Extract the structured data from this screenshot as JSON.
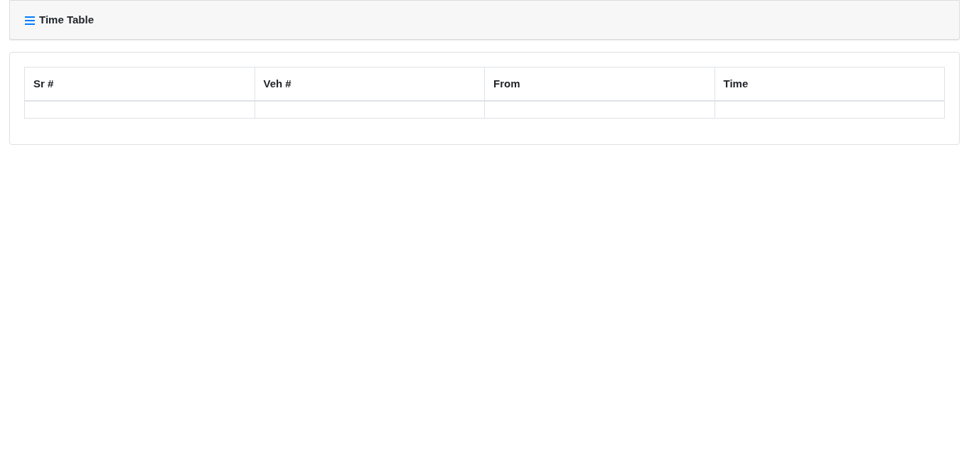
{
  "header": {
    "title": "Time Table"
  },
  "table": {
    "columns": [
      "Sr #",
      "Veh #",
      "From",
      "Time"
    ]
  }
}
